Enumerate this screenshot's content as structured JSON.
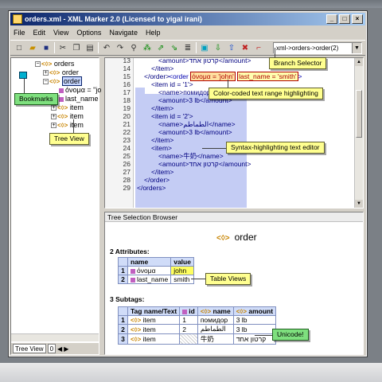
{
  "window": {
    "title": "orders.xml - XML Marker 2.0 (Licensed to yigal irani)",
    "min": "_",
    "max": "□",
    "close": "×"
  },
  "menu": [
    "File",
    "Edit",
    "View",
    "Options",
    "Navigate",
    "Help"
  ],
  "path_selector": {
    "value": "xml->orders->order(2)"
  },
  "tree": {
    "root": "orders",
    "nodes": [
      "order",
      "order",
      "όνομα = \"jo",
      "last_name",
      "item",
      "item",
      "item"
    ]
  },
  "left_tabs": {
    "tree": "Tree View",
    "other": "0"
  },
  "editor": {
    "lines": [
      {
        "n": "13",
        "indent": 3,
        "code": "<amount>קרטון אחד</amount>"
      },
      {
        "n": "14",
        "indent": 2,
        "code": "</item>"
      },
      {
        "n": "15",
        "indent": 1,
        "code": "</order>"
      },
      {
        "n": "16",
        "indent": 2,
        "code": "<item id = '1'>"
      },
      {
        "n": "17",
        "indent": 3,
        "code": "<name>помидор</name>"
      },
      {
        "n": "18",
        "indent": 3,
        "code": "<amount>3 lb</amount>"
      },
      {
        "n": "19",
        "indent": 2,
        "code": "</item>"
      },
      {
        "n": "20",
        "indent": 2,
        "code": "<item id = '2'>"
      },
      {
        "n": "21",
        "indent": 3,
        "code": "<name>الطماطم</name>"
      },
      {
        "n": "22",
        "indent": 3,
        "code": "<amount>3 lb</amount>"
      },
      {
        "n": "23",
        "indent": 2,
        "code": "</item>"
      },
      {
        "n": "24",
        "indent": 2,
        "code": "<item>"
      },
      {
        "n": "25",
        "indent": 3,
        "code": "<name>牛奶</name>"
      },
      {
        "n": "26",
        "indent": 3,
        "code": "<amount>קרטון אחד</amount>"
      },
      {
        "n": "27",
        "indent": 2,
        "code": "</item>"
      },
      {
        "n": "28",
        "indent": 1,
        "code": "</order>"
      },
      {
        "n": "29",
        "indent": 0,
        "code": "</orders>"
      }
    ],
    "line15_extra": {
      "open": "<order ",
      "attr1": "όνομα = 'john'",
      "attr2": "last_name = 'smith'",
      "close": ">"
    }
  },
  "browser": {
    "header": "Tree Selection Browser",
    "node": "order",
    "attrs_label": "2 Attributes:",
    "attr_cols": [
      "name",
      "value"
    ],
    "attrs": [
      {
        "i": "1",
        "name": "όνομα",
        "value": "john"
      },
      {
        "i": "2",
        "name": "last_name",
        "value": "smith"
      }
    ],
    "subtags_label": "3 Subtags:",
    "sub_cols": [
      "Tag name/Text",
      "id",
      "name",
      "amount"
    ],
    "subtags": [
      {
        "i": "1",
        "tag": "item",
        "id": "1",
        "name": "помидор",
        "amount": "3 lb"
      },
      {
        "i": "2",
        "tag": "item",
        "id": "2",
        "name": "الطماطم",
        "amount": "3 lb"
      },
      {
        "i": "3",
        "tag": "item",
        "id": "",
        "name": "牛奶",
        "amount": "קרטון אחד"
      }
    ]
  },
  "callouts": {
    "branch": "Branch Selector",
    "color": "Color-coded text range  highlighting",
    "syntax": "Syntax-highlighting text editor",
    "bookmarks": "Bookmarks",
    "treeview": "Tree View",
    "tableviews": "Table Views",
    "unicode": "Unicode!"
  },
  "colors": {
    "title_start": "#0a246a",
    "highlight": "#c4ccf4",
    "callout": "#ffff90",
    "callout_green": "#7ee07e"
  }
}
